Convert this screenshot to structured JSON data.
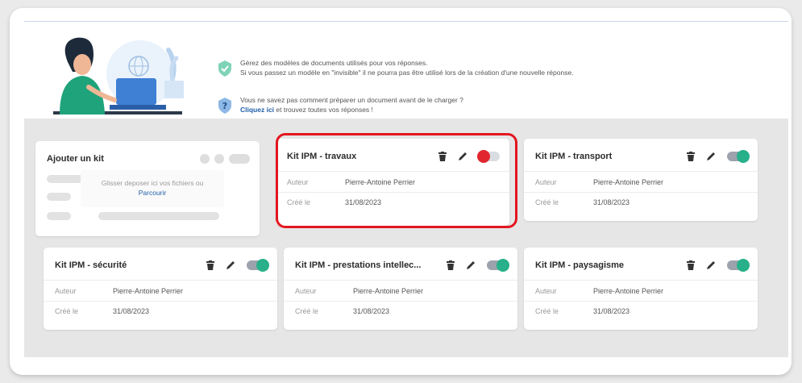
{
  "banner": {
    "tip1_line1": "Gérez des modèles de documents utilisés pour vos réponses.",
    "tip1_line2": "Si vous passez un modèle en \"invisible\" il ne pourra pas être utilisé lors de la création d'une nouvelle réponse.",
    "tip2_line1": "Vous ne savez pas comment préparer un document avant de le charger ?",
    "tip2_link": "Cliquez ici",
    "tip2_rest": " et trouvez toutes vos réponses !"
  },
  "add_kit": {
    "title": "Ajouter un kit",
    "drop_text": "Glisser deposer ici vos fichiers ou",
    "browse": "Parcourir"
  },
  "labels": {
    "author": "Auteur",
    "created": "Créé le"
  },
  "kits": [
    {
      "title": "Kit IPM - travaux",
      "author": "Pierre-Antoine  Perrier",
      "created": "31/08/2023",
      "visible": false
    },
    {
      "title": "Kit IPM - transport",
      "author": "Pierre-Antoine  Perrier",
      "created": "31/08/2023",
      "visible": true
    },
    {
      "title": "Kit IPM - sécurité",
      "author": "Pierre-Antoine  Perrier",
      "created": "31/08/2023",
      "visible": true
    },
    {
      "title": "Kit IPM - prestations intellec...",
      "author": "Pierre-Antoine  Perrier",
      "created": "31/08/2023",
      "visible": true
    },
    {
      "title": "Kit IPM - paysagisme",
      "author": "Pierre-Antoine  Perrier",
      "created": "31/08/2023",
      "visible": true
    }
  ],
  "colors": {
    "accent_green": "#27b08a",
    "alert_red": "#e2262f",
    "link_blue": "#1f5fa8"
  },
  "icons": {
    "delete": "trash-icon",
    "edit": "pencil-icon",
    "visible": "toggle-on",
    "hidden": "toggle-off"
  }
}
